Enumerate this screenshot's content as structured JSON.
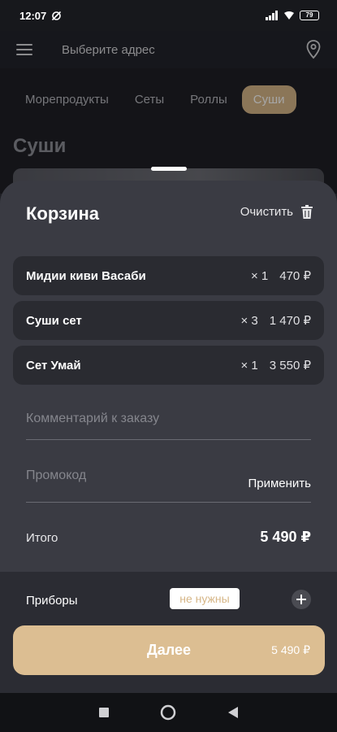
{
  "status": {
    "time": "12:07",
    "battery": "79"
  },
  "header": {
    "address": "Выберите адрес"
  },
  "categories": [
    {
      "label": "Морепродукты",
      "active": false
    },
    {
      "label": "Сеты",
      "active": false
    },
    {
      "label": "Роллы",
      "active": false
    },
    {
      "label": "Суши",
      "active": true
    }
  ],
  "section_title": "Суши",
  "cart": {
    "title": "Корзина",
    "clear_label": "Очистить",
    "items": [
      {
        "name": "Мидии киви Васаби",
        "qty": "× 1",
        "price": "470 ₽"
      },
      {
        "name": "Суши сет",
        "qty": "× 3",
        "price": "1 470 ₽"
      },
      {
        "name": "Сет Умай",
        "qty": "× 1",
        "price": "3 550 ₽"
      }
    ],
    "comment_placeholder": "Комментарий к заказу",
    "promo_placeholder": "Промокод",
    "apply_label": "Применить",
    "total_label": "Итого",
    "total_value": "5 490 ₽",
    "cutlery_label": "Приборы",
    "cutlery_value": "не нужны",
    "next_label": "Далее",
    "next_price": "5 490 ₽"
  },
  "colors": {
    "accent": "#dcbe92",
    "sheet": "#3a3b43",
    "item_bg": "#2a2b31",
    "background": "#1f2026"
  }
}
